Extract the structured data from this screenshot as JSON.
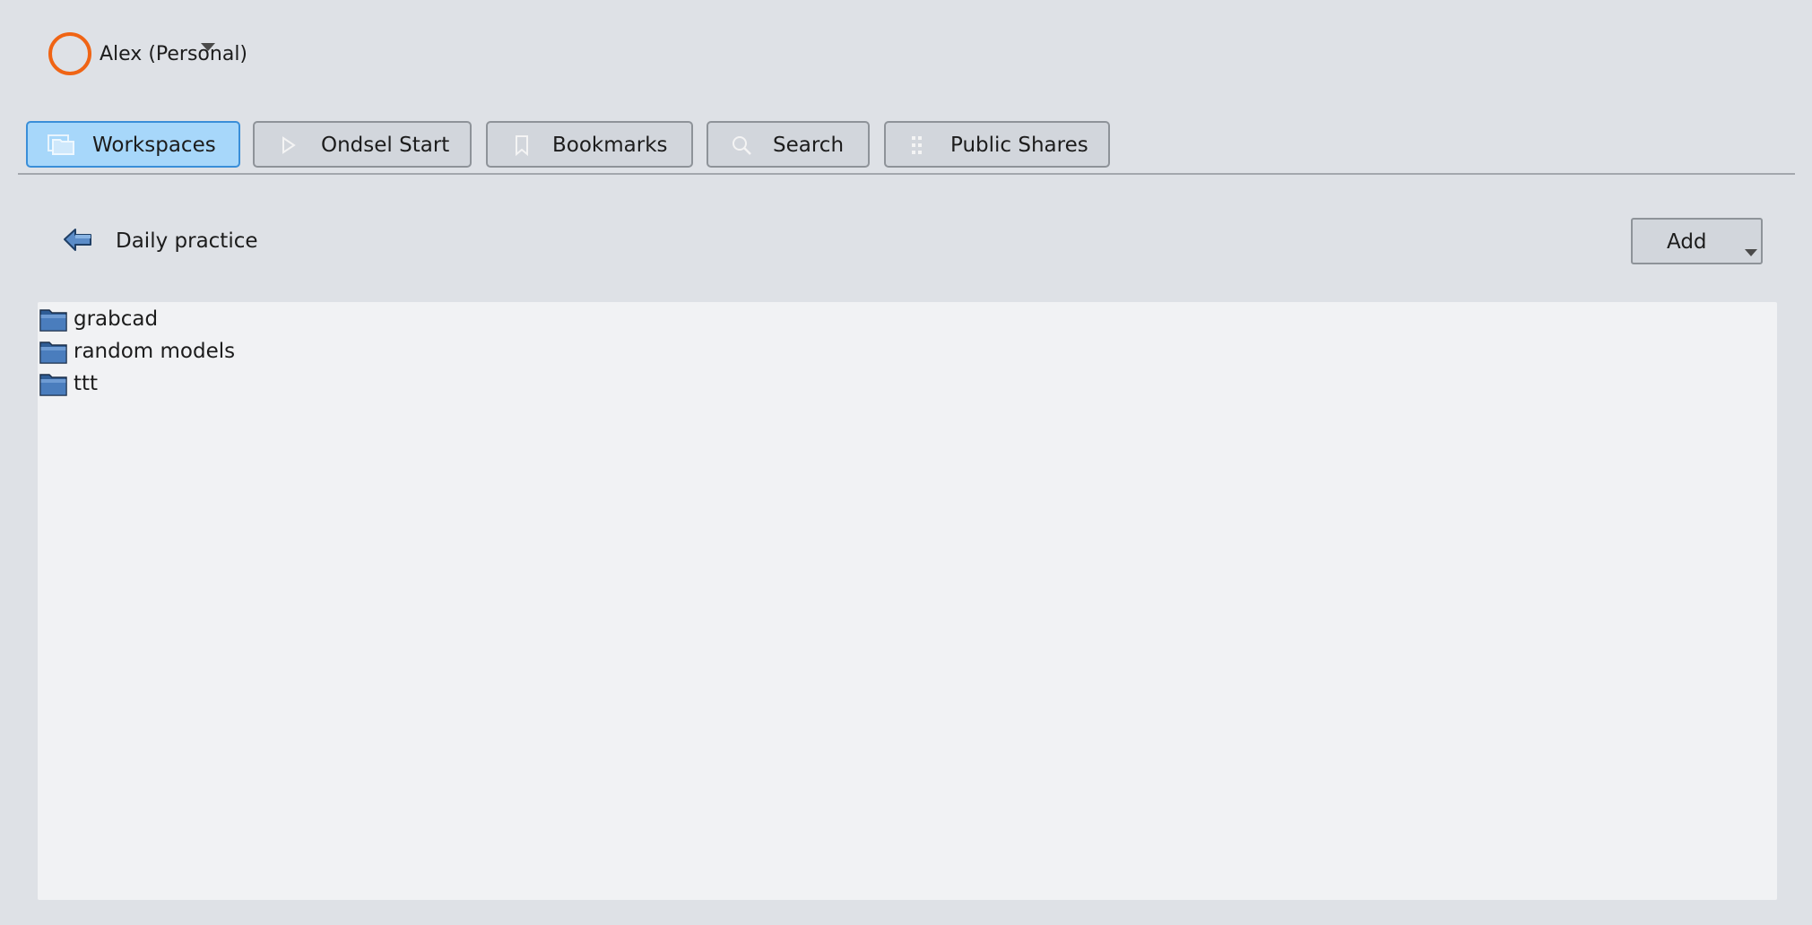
{
  "account": {
    "name": "Alex (Personal)",
    "avatar_color": "#f06414"
  },
  "tabs": [
    {
      "label": "Workspaces",
      "icon": "folders-icon",
      "active": true
    },
    {
      "label": "Ondsel Start",
      "icon": "play-icon",
      "active": false
    },
    {
      "label": "Bookmarks",
      "icon": "bookmark-icon",
      "active": false
    },
    {
      "label": "Search",
      "icon": "search-icon",
      "active": false
    },
    {
      "label": "Public Shares",
      "icon": "grid-icon",
      "active": false
    }
  ],
  "path": {
    "title": "Daily practice",
    "back_icon": "back-arrow-icon"
  },
  "add_button": {
    "label": "Add"
  },
  "files": [
    {
      "name": "grabcad",
      "icon": "folder-icon"
    },
    {
      "name": "random models",
      "icon": "folder-icon"
    },
    {
      "name": "ttt",
      "icon": "folder-icon"
    }
  ],
  "colors": {
    "background": "#dee1e6",
    "active_tab": "#a7d7fa",
    "active_tab_border": "#3a8ed8",
    "list_background": "#f1f2f4",
    "folder_blue": "#3f6ea8"
  }
}
